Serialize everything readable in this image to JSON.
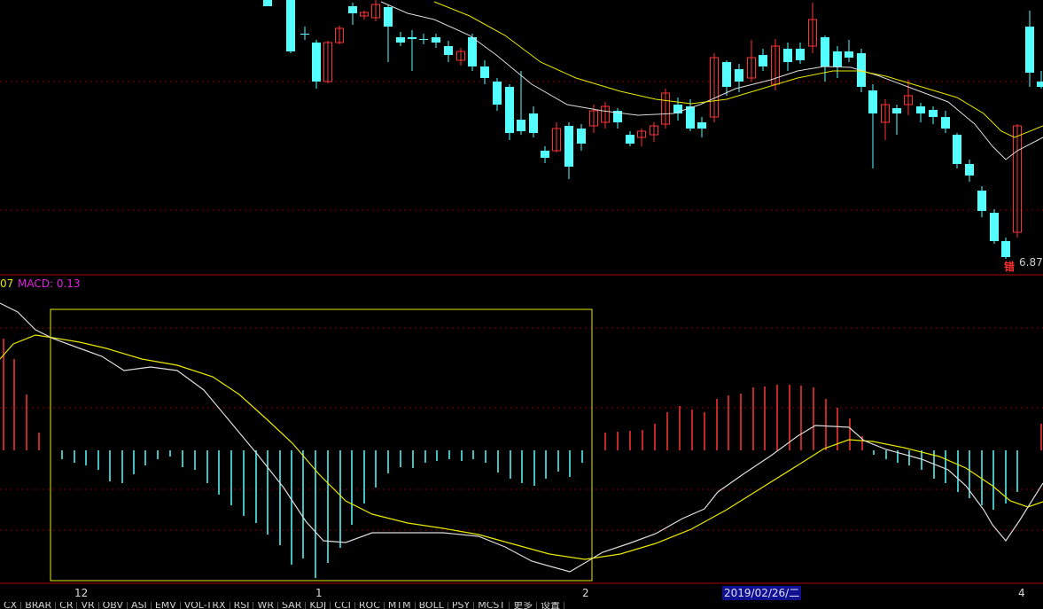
{
  "indicator": {
    "macd_prefix": "07",
    "macd_label": "MACD: 0.13"
  },
  "price_panel": {
    "low_price": "6.87",
    "low_marker": "错"
  },
  "time_axis": {
    "ticks": [
      "12",
      "1",
      "2",
      "4"
    ],
    "cursor_date": "2019/02/26/二"
  },
  "indicator_tabs": [
    "CX",
    "BRAR",
    "CR",
    "VR",
    "OBV",
    "ASI",
    "EMV",
    "VOL-TRX",
    "RSI",
    "WR",
    "SAR",
    "KDJ",
    "CCI",
    "ROC",
    "MTM",
    "BOLL",
    "PSY",
    "MCST",
    "更多",
    "设置"
  ],
  "colors": {
    "up_candle": "#ff3232",
    "down_candle": "#54ffff",
    "ma_short": "#dcdcdc",
    "ma_long": "#e8e800",
    "dea_line": "#e8e800",
    "dif_line": "#dcdcdc",
    "grid": "#800000",
    "selection_box": "#e8e800"
  }
}
